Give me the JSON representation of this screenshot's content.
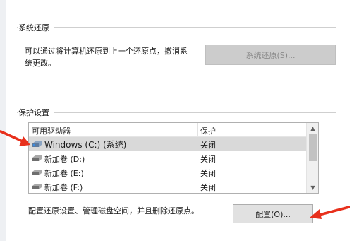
{
  "system_restore": {
    "title": "系统还原",
    "description": "可以通过将计算机还原到上一个还原点，撤消系统更改。",
    "description_line1": "可以通过将计算机还原到上一个还原点，撤消系",
    "description_line2": "统更改。",
    "button_label": "系统还原(S)..."
  },
  "protection": {
    "title": "保护设置",
    "columns": [
      "可用驱动器",
      "保护"
    ],
    "drives": [
      {
        "name": "Windows (C:) (系统)",
        "status": "关闭",
        "selected": true,
        "icon": "system-drive-icon"
      },
      {
        "name": "新加卷 (D:)",
        "status": "关闭",
        "selected": false,
        "icon": "drive-icon"
      },
      {
        "name": "新加卷 (E:)",
        "status": "关闭",
        "selected": false,
        "icon": "drive-icon"
      },
      {
        "name": "新加卷 (F:)",
        "status": "关闭",
        "selected": false,
        "icon": "drive-icon"
      }
    ],
    "configure_text": "配置还原设置、管理磁盘空间，并且删除还原点。",
    "configure_button": "配置(O)..."
  },
  "annotations": {
    "arrow_color": "#e8301c"
  }
}
